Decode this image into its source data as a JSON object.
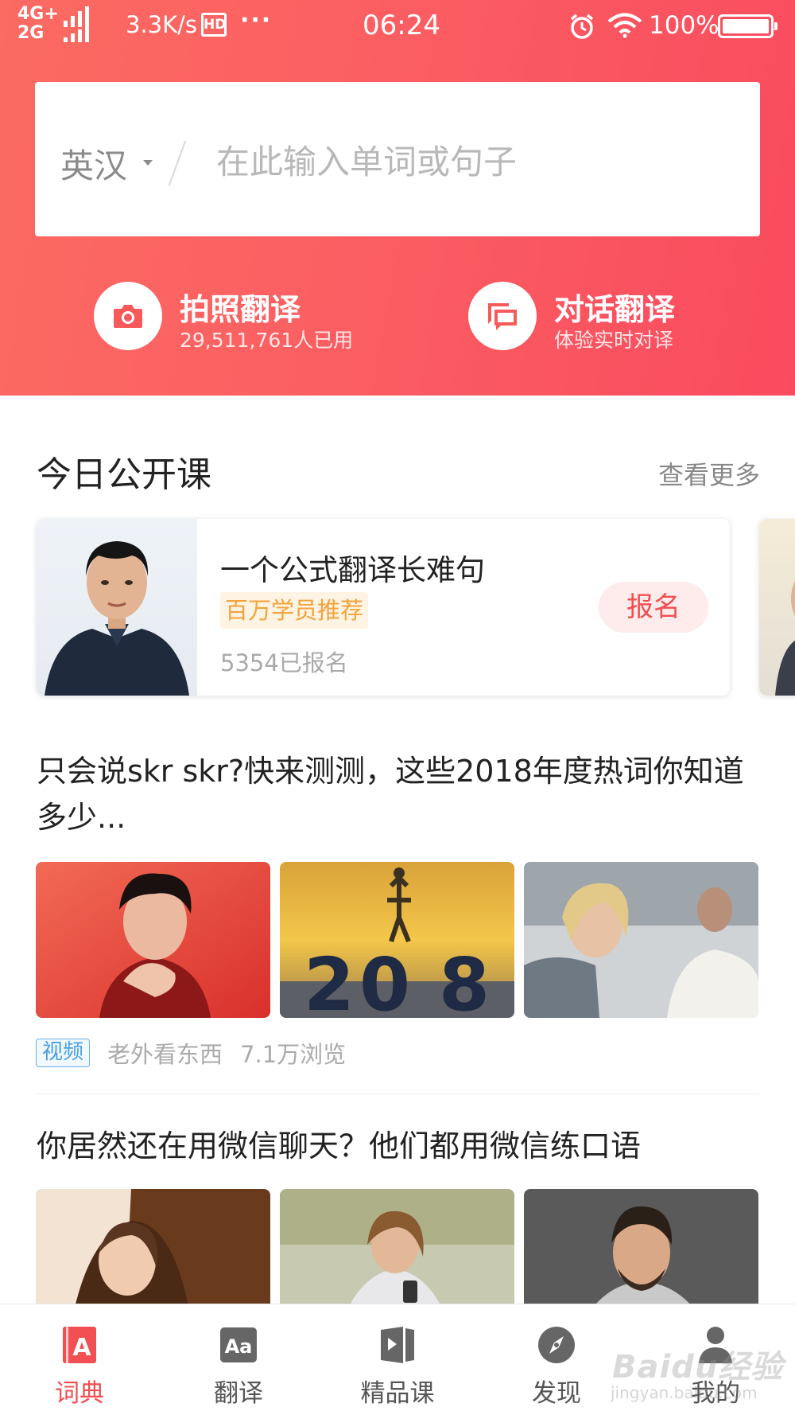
{
  "status_bar": {
    "network_top": "4G+",
    "network_bottom": "2G",
    "speed": "3.3K/s",
    "hd_label": "HD",
    "dots": "···",
    "time": "06:24",
    "battery": "100%"
  },
  "search": {
    "language": "英汉",
    "placeholder": "在此输入单词或句子"
  },
  "quick_actions": {
    "photo": {
      "title": "拍照翻译",
      "subtitle": "29,511,761人已用",
      "icon": "camera-icon"
    },
    "chat": {
      "title": "对话翻译",
      "subtitle": "体验实时对译",
      "icon": "chat-bubbles-icon"
    }
  },
  "open_class": {
    "section_title": "今日公开课",
    "more": "查看更多",
    "course": {
      "title": "一个公式翻译长难句",
      "tag": "百万学员推荐",
      "enrolled": "5354已报名",
      "enroll_button": "报名"
    }
  },
  "articles": [
    {
      "title": "只会说skr skr?快来测测，这些2018年度热词你知道多少...",
      "tag": "视频",
      "source": "老外看东西",
      "views": "7.1万浏览",
      "thumb_digits": [
        "2",
        "0",
        "8"
      ]
    },
    {
      "title": "你居然还在用微信聊天？他们都用微信练口语"
    }
  ],
  "tabbar": {
    "items": [
      {
        "label": "词典",
        "icon": "dictionary-icon",
        "active": true
      },
      {
        "label": "翻译",
        "icon": "translate-aa-icon",
        "active": false
      },
      {
        "label": "精品课",
        "icon": "course-play-icon",
        "active": false
      },
      {
        "label": "发现",
        "icon": "compass-icon",
        "active": false
      },
      {
        "label": "我的",
        "icon": "profile-icon",
        "active": false
      }
    ]
  },
  "watermark": {
    "text": "Baidu经验",
    "sub": "jingyan.baidu.com"
  },
  "colors": {
    "brand_red": "#f24f52",
    "header_gradient_start": "#fb6b62",
    "header_gradient_end": "#f94b5e",
    "tag_orange": "#f2a33c",
    "video_tag_blue": "#4a9fe2"
  }
}
